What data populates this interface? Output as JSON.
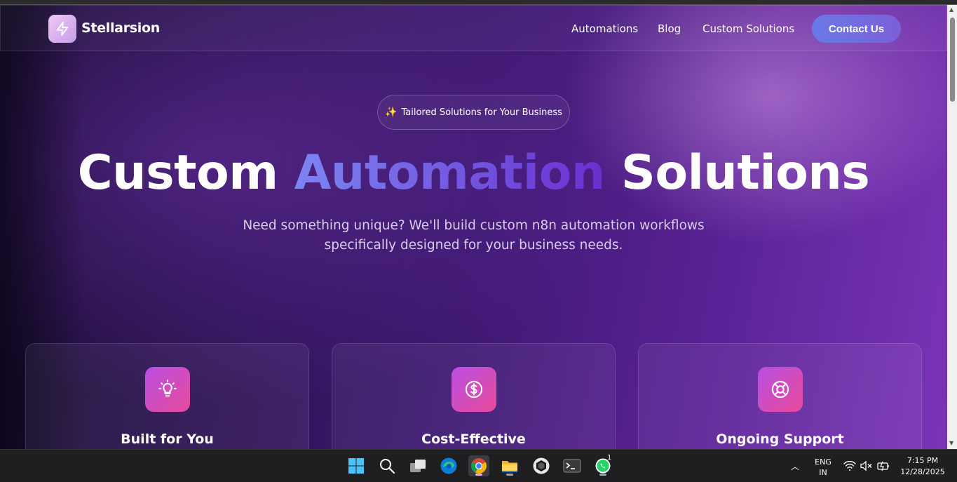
{
  "navbar": {
    "brand": "Stellarsion",
    "links": [
      "Automations",
      "Blog",
      "Custom Solutions"
    ],
    "contact_label": "Contact Us"
  },
  "hero": {
    "badge_icon": "sparkles-icon",
    "badge_text": "Tailored Solutions for Your Business",
    "title_part1": "Custom ",
    "title_highlight": "Automation",
    "title_part2": " Solutions",
    "subtitle_line1": "Need something unique? We'll build custom n8n automation workflows",
    "subtitle_line2": "specifically designed for your business needs."
  },
  "cards": [
    {
      "icon": "lightbulb-icon",
      "title": "Built for You"
    },
    {
      "icon": "dollar-icon",
      "title": "Cost-Effective"
    },
    {
      "icon": "lifebuoy-icon",
      "title": "Ongoing Support"
    }
  ],
  "taskbar": {
    "apps": [
      "windows-start",
      "search",
      "task-view",
      "edge",
      "chrome",
      "file-explorer",
      "app-hexagon",
      "terminal",
      "whatsapp"
    ],
    "whatsapp_badge": "1",
    "lang_line1": "ENG",
    "lang_line2": "IN",
    "time": "7:15 PM",
    "date": "12/28/2025"
  },
  "colors": {
    "accent": "#6a7ae8",
    "icon_gradient_start": "#b94fe3",
    "icon_gradient_end": "#e84a9a"
  }
}
